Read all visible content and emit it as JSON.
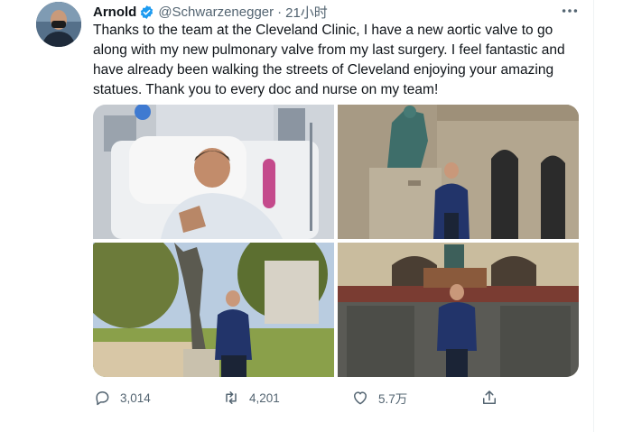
{
  "author": {
    "name": "Arnold",
    "handle": "@Schwarzenegger",
    "separator": "·",
    "time": "21小时",
    "verified": true
  },
  "tweet_text": "Thanks to the team at the Cleveland Clinic, I have a new aortic valve to go\nalong with my new pulmonary valve from my last surgery. I feel fantastic and\nhave already been walking the streets of Cleveland enjoying your amazing\nstatues. Thank you to every doc and nurse on my team!",
  "media": [
    {
      "icon": "hospital-bed-photo"
    },
    {
      "icon": "building-statue-photo"
    },
    {
      "icon": "park-statue-photo"
    },
    {
      "icon": "monument-photo"
    }
  ],
  "actions": {
    "reply_count": "3,014",
    "retweet_count": "4,201",
    "like_count": "5.7万"
  },
  "colors": {
    "text": "#0f1419",
    "secondary": "#536471",
    "verified": "#1d9bf0"
  }
}
